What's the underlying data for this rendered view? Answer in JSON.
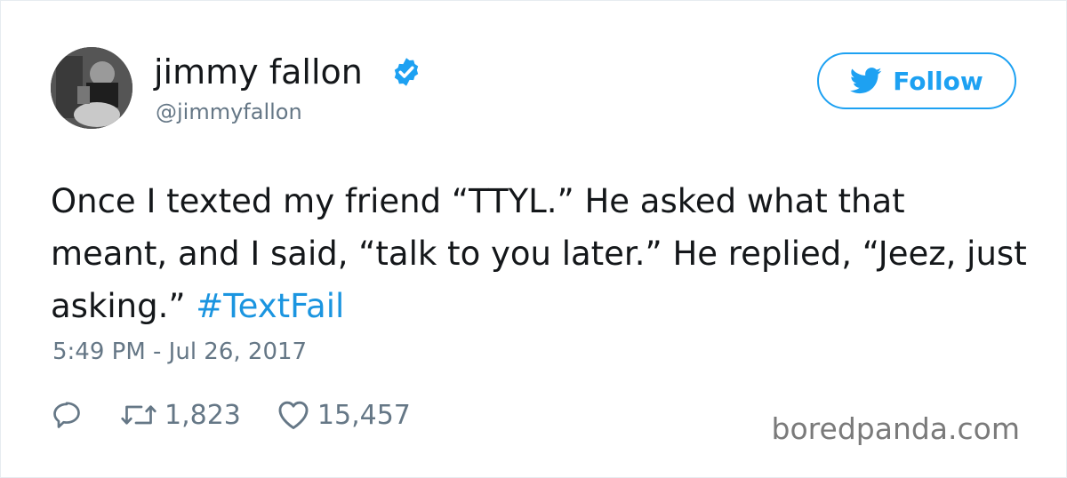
{
  "author": {
    "display_name": "jimmy fallon",
    "handle": "@jimmyfallon",
    "verified": true
  },
  "follow_button": {
    "label": "Follow",
    "icon": "twitter-bird-icon"
  },
  "tweet": {
    "text": "Once I texted my friend “TTYL.” He asked what that meant, and I said, “talk to you later.” He replied, “Jeez, just asking.” ",
    "hashtag": "#TextFail",
    "timestamp": "5:49 PM - Jul 26, 2017"
  },
  "actions": {
    "reply_icon": "reply-icon",
    "retweet_icon": "retweet-icon",
    "retweet_count": "1,823",
    "like_icon": "heart-icon",
    "like_count": "15,457"
  },
  "watermark": "boredpanda.com",
  "colors": {
    "accent": "#1da1f2",
    "hashtag": "#1b95e0",
    "muted": "#657786",
    "text": "#14171a"
  }
}
